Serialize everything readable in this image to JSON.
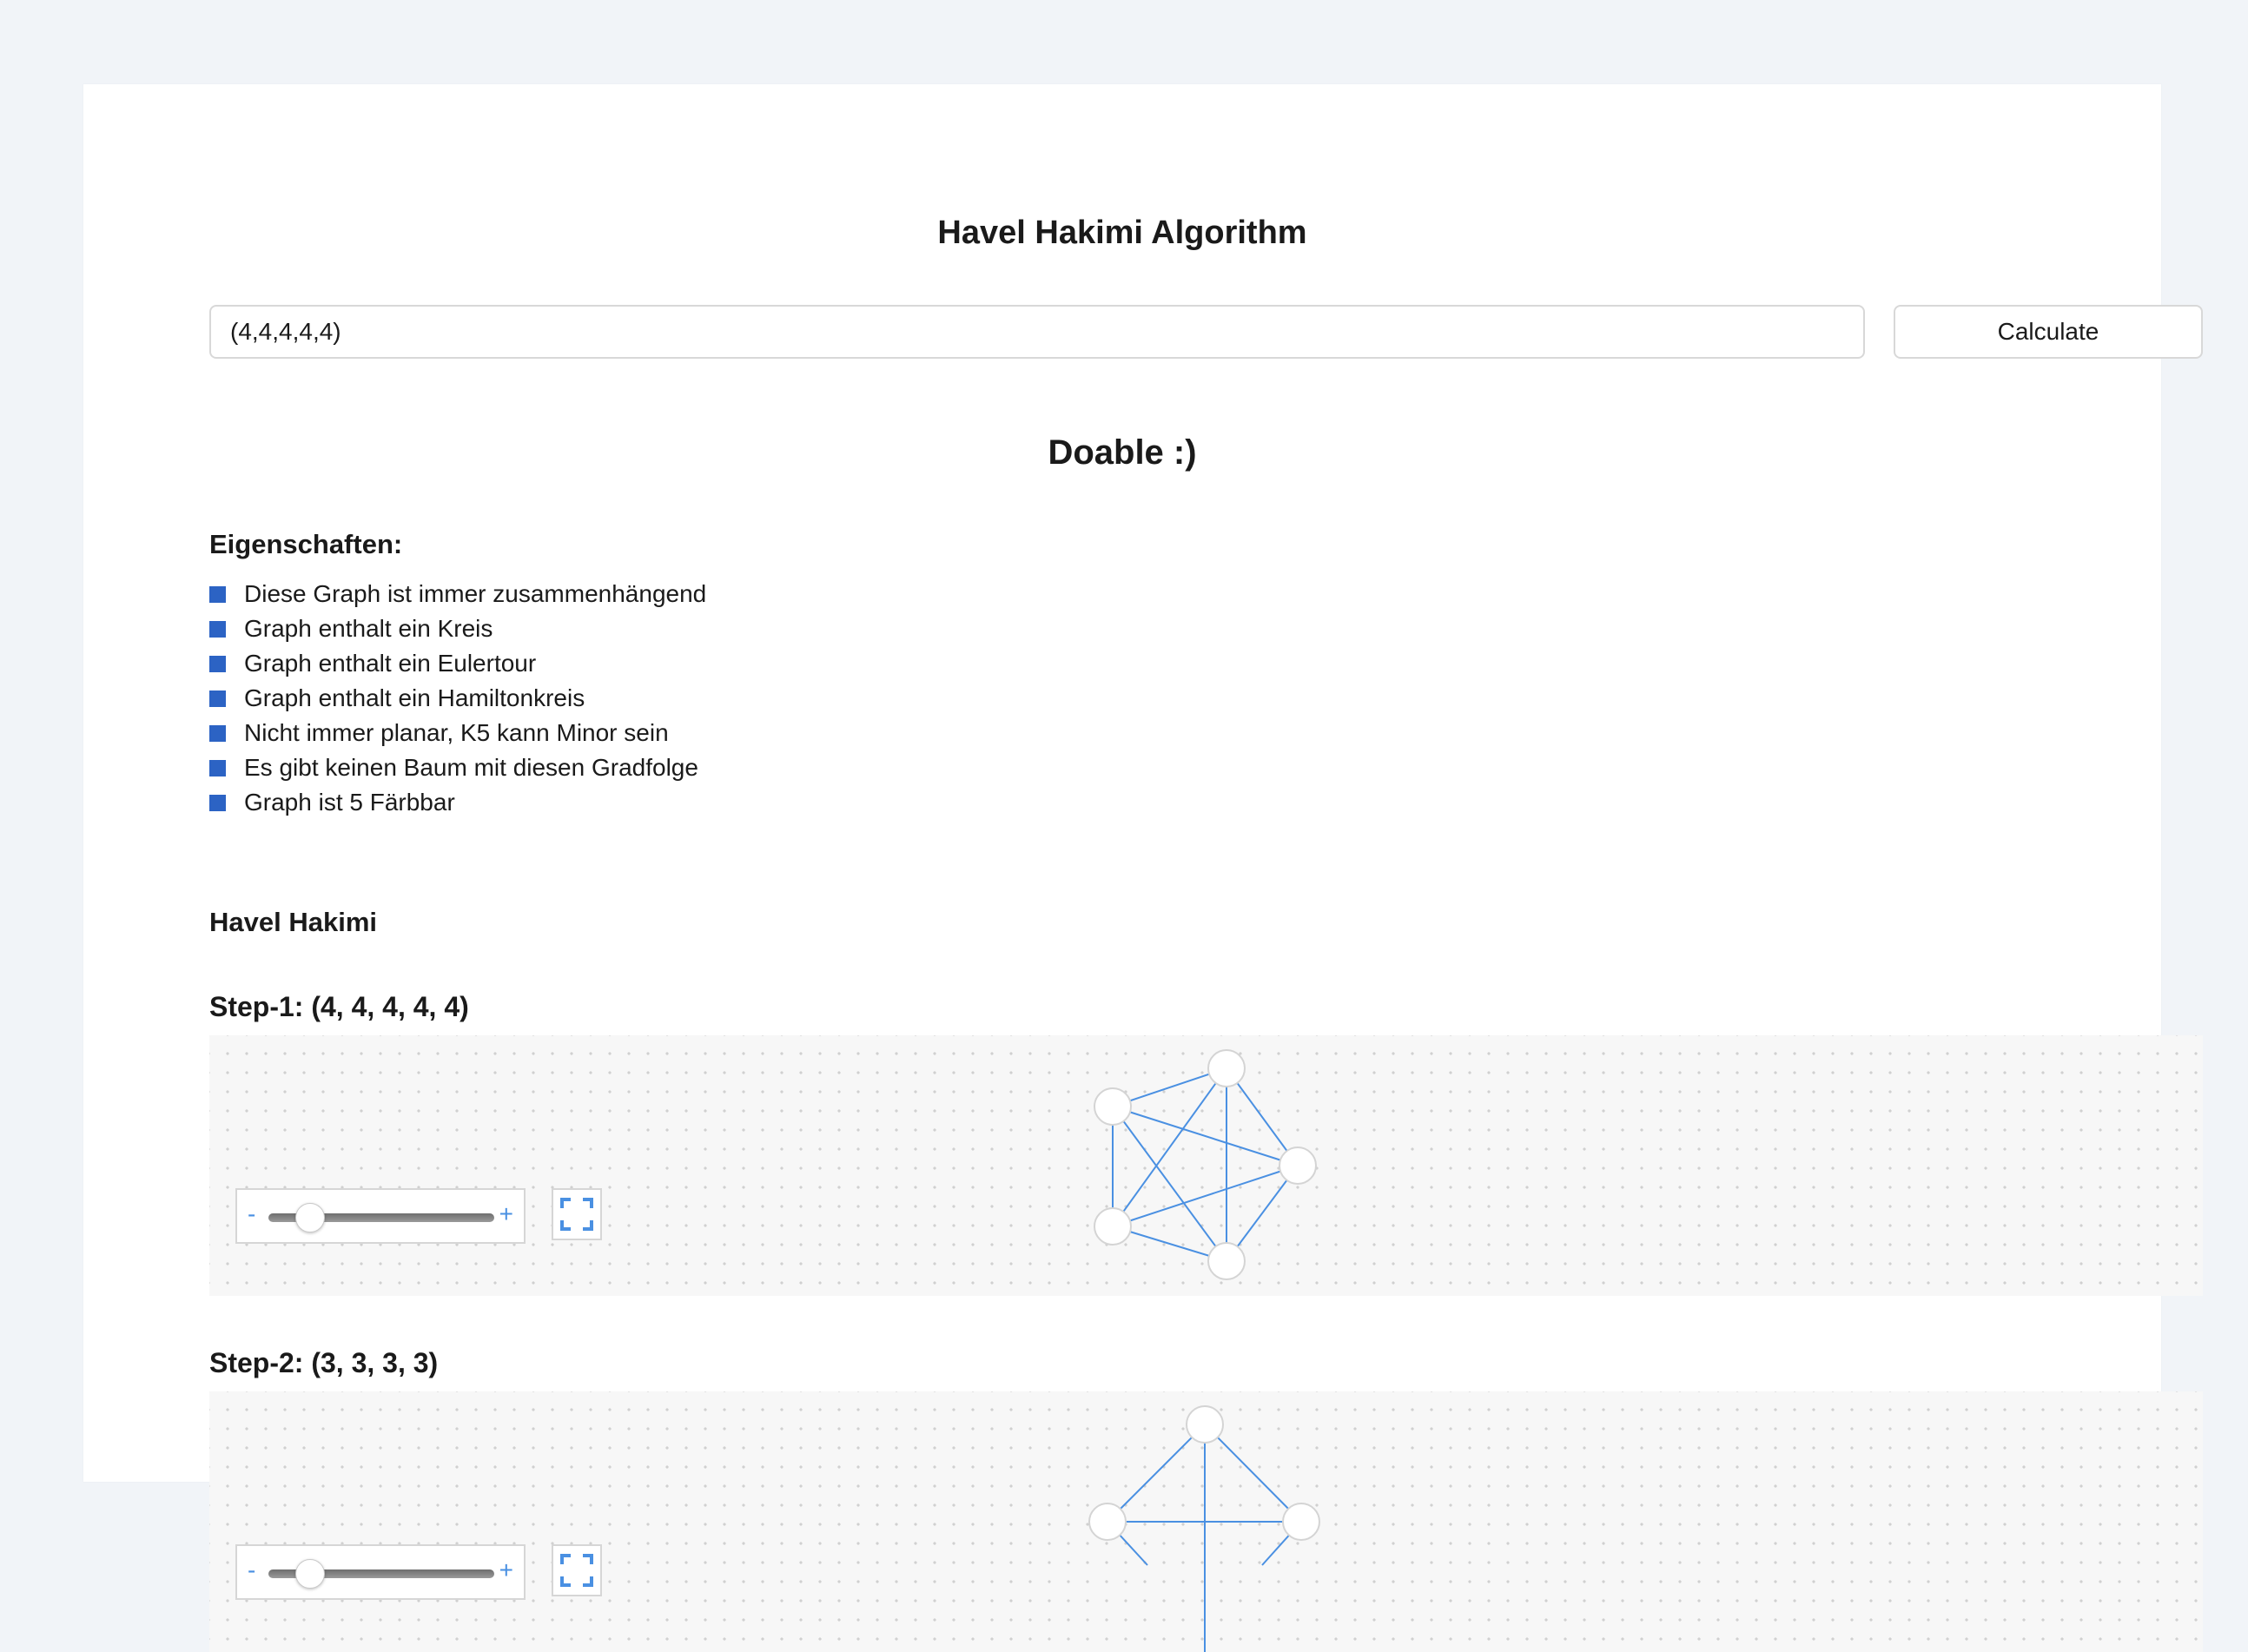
{
  "header": {
    "title": "Havel Hakimi Algorithm"
  },
  "input": {
    "value": "(4,4,4,4,4)",
    "calculate_label": "Calculate"
  },
  "result": {
    "text": "Doable :)"
  },
  "properties": {
    "heading": "Eigenschaften:",
    "items": [
      "Diese Graph ist immer zusammenhängend",
      "Graph enthalt ein Kreis",
      "Graph enthalt ein Eulertour",
      "Graph enthalt ein Hamiltonkreis",
      "Nicht immer planar, K5 kann Minor sein",
      "Es gibt keinen Baum mit diesen Gradfolge",
      "Graph ist 5 Färbbar"
    ]
  },
  "havel_hakimi": {
    "heading": "Havel Hakimi",
    "steps": [
      {
        "label": "Step-1: (4, 4, 4, 4, 4)"
      },
      {
        "label": "Step-2: (3, 3, 3, 3)"
      }
    ]
  },
  "graph_controls": {
    "zoom_minus": "-",
    "zoom_plus": "+",
    "zoom_level": 0.2,
    "fullscreen_icon": "fullscreen-icon"
  },
  "colors": {
    "accent": "#4a90e2",
    "bullet": "#2c63c4",
    "edge": "#4a90e2"
  }
}
